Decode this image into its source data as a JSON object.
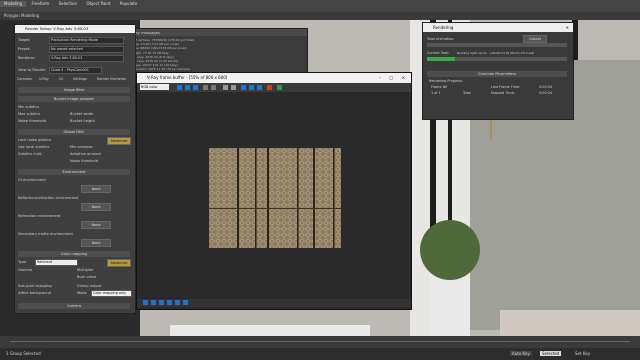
{
  "app": {
    "title_left": "3ds Max",
    "menu": [
      "Modeling",
      "Freeform",
      "Selection",
      "Object Paint",
      "Populate"
    ],
    "submenu": "Polygon Modeling"
  },
  "render_setup": {
    "title": "Render Setup: V-Ray Adv 3.60.03",
    "target_label": "Target:",
    "target_value": "Production Rendering Mode",
    "preset_label": "Preset:",
    "preset_value": "No preset selected",
    "renderer_label": "Renderer:",
    "renderer_value": "V-Ray Adv 3.60.03",
    "view_label": "View to Render:",
    "view_value": "Quad 4 - PhysCam001",
    "tabs": [
      "Common",
      "V-Ray",
      "GI",
      "Settings",
      "Render Elements"
    ],
    "section_image_filter": "Image filter",
    "section_bucket": "Bucket image sampler",
    "min_subdivs_label": "Min subdivs",
    "max_subdivs_label": "Max subdivs",
    "noise_label": "Noise threshold",
    "bucket_width_label": "Bucket width",
    "bucket_height_label": "Bucket height",
    "section_global_dmc": "Global DMC",
    "lock_noise_label": "Lock noise pattern",
    "use_local_label": "Use local subdivs",
    "subdivs_mult_label": "Subdivs mult.",
    "min_samples_label": "Min samples",
    "adaptive_amount_label": "Adaptive amount",
    "noise_threshold_label": "Noise threshold",
    "advanced_label": "Advanced",
    "section_environment": "Environment",
    "gi_env_label": "GI environment",
    "refl_env_label": "Reflection/refraction environment",
    "refr_env_label": "Refraction environment",
    "secondary_label": "Secondary matte environment",
    "none_label": "None",
    "section_color": "Color mapping",
    "type_label": "Type",
    "type_value": "Reinhard",
    "gamma_label": "Gamma",
    "multiplier_label": "Multiplier",
    "burn_label": "Burn value",
    "subpixel_label": "Sub-pixel mapping",
    "clamp_label": "Clamp output",
    "affect_bg_label": "Affect background",
    "mode_label": "Mode",
    "mode_value": "Color mapping only",
    "camera_label": "Camera"
  },
  "messages": {
    "title": "V-Ray messages",
    "lines": [
      "Number of vertices: 73780640 (276.00 pct total)",
      "Listing: tree: 13.00 (7.01 KB per node)",
      "Photon tree: 86400 (184.7234 KB per pixel)",
      "Shading calls: 77 94 75 KB tally",
      "Reflection rays: 4576 00 (6 lb tally)",
      "Refraction rays: 4035 00 (1.35 bands)",
      "Shadow rays: 15527 101 11 (76 tally)",
      "Lights evaluated: 4476 11 26 (76 per sample)"
    ]
  },
  "vfb": {
    "title": "V-Ray frame buffer - [55% of 800 x 600]",
    "channel": "RGB color"
  },
  "progress": {
    "title": "Rendering",
    "cancel_label": "Cancel",
    "total_animation_label": "Total Animation:",
    "current_task_label": "Current Task:",
    "current_task_value": "Building light cache... [00:00:21.8] [00:01:23.0 est]",
    "common_params_label": "Common Parameters",
    "rendering_progress_label": "Rendering Progress:",
    "frame_label": "Frame #",
    "frame_value": "0",
    "of_label": "1 of 1",
    "total_label": "Total",
    "last_frame_label": "Last Frame Time:",
    "last_frame_value": "0:00:24",
    "elapsed_label": "Elapsed Time:",
    "elapsed_value": "0:00:24"
  },
  "status": {
    "selection": "1 Group Selected",
    "auto_key": "Auto Key",
    "selected": "Selected",
    "set_key": "Set Key"
  },
  "colors": {
    "accent_blue": "#1e73d2",
    "progress_green": "#3fa64a",
    "gold_frame": "#a88e52"
  }
}
